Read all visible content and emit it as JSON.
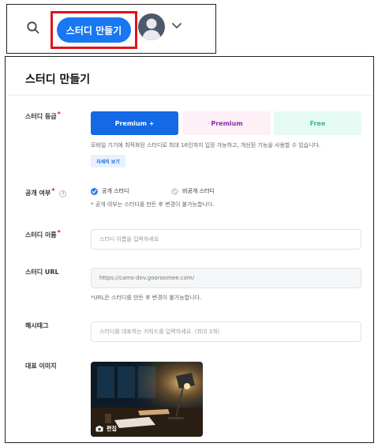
{
  "header": {
    "create_study_label": "스터디 만들기",
    "icons": {
      "search": "search-icon",
      "avatar": "avatar",
      "menu": "chevron-down-icon"
    }
  },
  "panel": {
    "title": "스터디 만들기",
    "tier": {
      "label": "스터디 등급",
      "required_mark": "*",
      "options": [
        "Premium +",
        "Premium",
        "Free"
      ],
      "selected": "Premium +",
      "description": "모바일 기기에 최적화된 스터디로 최대 16인까지 입장 가능하고, 개선된 기능을 사용할 수 있습니다.",
      "detail_button": "자세히 보기"
    },
    "visibility": {
      "label": "공개 여부",
      "required_mark": "*",
      "help": "?",
      "options": [
        "공개 스터디",
        "비공개 스터디"
      ],
      "selected": "공개 스터디",
      "note": "* 공개 여부는 스터디를 만든 후 변경이 불가능합니다."
    },
    "name": {
      "label": "스터디 이름",
      "required_mark": "*",
      "placeholder": "스터디 이름을 입력하세요"
    },
    "url": {
      "label": "스터디 URL",
      "value": "https://cams-dev.gooroomee.com/",
      "note": "*URL은 스터디를 만든 후 변경이 불가능합니다."
    },
    "hashtag": {
      "label": "해시태그",
      "placeholder": "스터디를 대표하는 키워드를 입력하세요. (최대 3개)"
    },
    "image": {
      "label": "대표 이미지",
      "edit_label": "편집"
    }
  },
  "colors": {
    "accent": "#1877f2",
    "highlight_border": "#e3111a",
    "premium_text": "#8a2aa8",
    "free_text": "#2bbf8c"
  }
}
